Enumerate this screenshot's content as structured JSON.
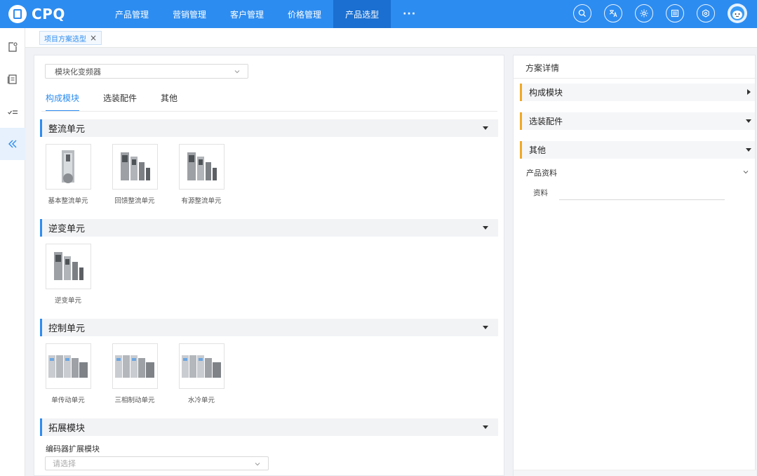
{
  "app": {
    "title": "CPQ"
  },
  "nav": {
    "items": [
      {
        "label": "产品管理"
      },
      {
        "label": "营销管理"
      },
      {
        "label": "客户管理"
      },
      {
        "label": "价格管理"
      },
      {
        "label": "产品选型"
      }
    ],
    "active_index": 4,
    "more_label": "···"
  },
  "header_icons": [
    "search-icon",
    "translate-icon",
    "theme-icon",
    "barcode-icon",
    "settings-icon",
    "avatar"
  ],
  "sidebar": {
    "items": [
      "new-document-icon",
      "list-icon",
      "checklist-icon",
      "collapse-icon"
    ],
    "active_index": 3
  },
  "tabstrip": {
    "tab_label": "项目方案选型",
    "close": "×"
  },
  "left_panel": {
    "product_select": {
      "value": "模块化变频器"
    },
    "tabs": [
      {
        "label": "构成模块"
      },
      {
        "label": "选装配件"
      },
      {
        "label": "其他"
      }
    ],
    "active_tab": 0,
    "sections": [
      {
        "title": "整流单元",
        "items": [
          {
            "label": "基本整流单元"
          },
          {
            "label": "回馈整流单元"
          },
          {
            "label": "有源整流单元"
          }
        ]
      },
      {
        "title": "逆变单元",
        "items": [
          {
            "label": "逆变单元"
          }
        ]
      },
      {
        "title": "控制单元",
        "items": [
          {
            "label": "单传动单元"
          },
          {
            "label": "三相制动单元"
          },
          {
            "label": "水冷单元"
          }
        ]
      },
      {
        "title": "拓展模块"
      }
    ],
    "extension": {
      "label": "编码器扩展模块",
      "placeholder": "请选择"
    }
  },
  "right_panel": {
    "title": "方案详情",
    "sections": [
      {
        "title": "构成模块"
      },
      {
        "title": "选装配件"
      },
      {
        "title": "其他"
      }
    ],
    "product_material": {
      "label": "产品资料",
      "field_label": "资料"
    }
  },
  "colors": {
    "primary": "#2d8cf0",
    "nav_active": "#1a6fd1",
    "accent_orange": "#f0a825",
    "section_bg": "#f2f3f5"
  }
}
